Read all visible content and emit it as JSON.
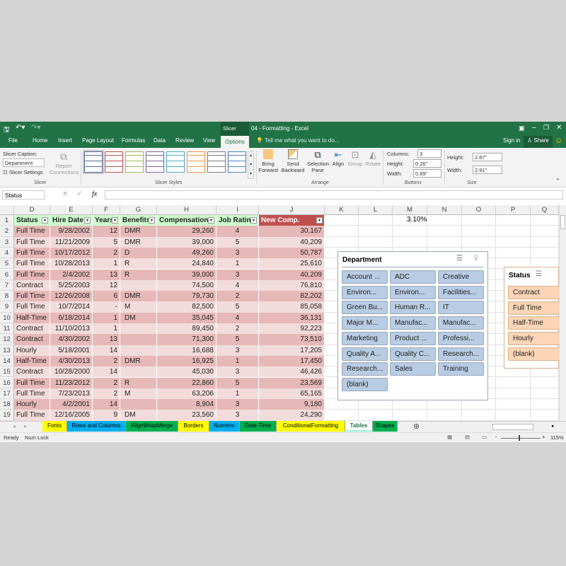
{
  "window": {
    "title": "04 - Formatting - Excel",
    "context_tab": "Slicer Tools",
    "sign_in": "Sign in",
    "share": "Share"
  },
  "ribbon_tabs": [
    "File",
    "Home",
    "Insert",
    "Page Layout",
    "Formulas",
    "Data",
    "Review",
    "View",
    "Options"
  ],
  "active_tab": "Options",
  "tell_me": "Tell me what you want to do...",
  "ribbon": {
    "slicer_caption_label": "Slicer Caption:",
    "slicer_caption_value": "Department",
    "slicer_settings": "Slicer Settings",
    "report_connections": "Report Connections",
    "group_slicer": "Slicer",
    "group_styles": "Slicer Styles",
    "style_colors": [
      "#4f6d9a",
      "#c0504d",
      "#9bbb59",
      "#8064a2",
      "#4bacc6",
      "#f79646",
      "#7f7f7f",
      "#4f81bd"
    ],
    "bring_forward": "Bring Forward",
    "send_backward": "Send Backward",
    "selection_pane": "Selection Pane",
    "align": "Align",
    "group": "Group",
    "rotate": "Rotate",
    "group_arrange": "Arrange",
    "columns_label": "Columns:",
    "columns_value": "3",
    "btn_height_label": "Height:",
    "btn_height_value": "0.26\"",
    "btn_width_label": "Width:",
    "btn_width_value": "0.89\"",
    "group_buttons": "Buttons",
    "size_height_label": "Height:",
    "size_height_value": "2.87\"",
    "size_width_label": "Width:",
    "size_width_value": "2.91\"",
    "group_size": "Size"
  },
  "formula_bar": {
    "name_box": "Status",
    "fx": "fx",
    "formula": ""
  },
  "columns": [
    "D",
    "E",
    "F",
    "G",
    "H",
    "I",
    "J",
    "K",
    "L",
    "M",
    "N",
    "O",
    "P",
    "Q"
  ],
  "table": {
    "headers": [
      "Status",
      "Hire Date",
      "Years",
      "Benefits",
      "Compensation",
      "Job Rating",
      "New Comp."
    ],
    "rows": [
      [
        "Full Time",
        "9/28/2002",
        "12",
        "DMR",
        "29,260",
        "4",
        "30,167"
      ],
      [
        "Full Time",
        "11/21/2009",
        "5",
        "DMR",
        "39,000",
        "5",
        "40,209"
      ],
      [
        "Full Time",
        "10/17/2012",
        "2",
        "D",
        "49,260",
        "3",
        "50,787"
      ],
      [
        "Full Time",
        "10/28/2013",
        "1",
        "R",
        "24,840",
        "1",
        "25,610"
      ],
      [
        "Full Time",
        "2/4/2002",
        "13",
        "R",
        "39,000",
        "3",
        "40,209"
      ],
      [
        "Contract",
        "5/25/2003",
        "12",
        "",
        "74,500",
        "4",
        "76,810"
      ],
      [
        "Full Time",
        "12/26/2008",
        "6",
        "DMR",
        "79,730",
        "2",
        "82,202"
      ],
      [
        "Full Time",
        "10/7/2014",
        "-",
        "M",
        "82,500",
        "5",
        "85,058"
      ],
      [
        "Half-Time",
        "6/18/2014",
        "1",
        "DM",
        "35,045",
        "4",
        "36,131"
      ],
      [
        "Contract",
        "11/10/2013",
        "1",
        "",
        "89,450",
        "2",
        "92,223"
      ],
      [
        "Contract",
        "4/30/2002",
        "13",
        "",
        "71,300",
        "5",
        "73,510"
      ],
      [
        "Hourly",
        "5/18/2001",
        "14",
        "",
        "16,688",
        "3",
        "17,205"
      ],
      [
        "Half-Time",
        "4/30/2013",
        "2",
        "DMR",
        "16,925",
        "1",
        "17,450"
      ],
      [
        "Contract",
        "10/28/2000",
        "14",
        "",
        "45,030",
        "3",
        "46,426"
      ],
      [
        "Full Time",
        "11/23/2012",
        "2",
        "R",
        "22,860",
        "5",
        "23,569"
      ],
      [
        "Full Time",
        "7/23/2013",
        "2",
        "M",
        "63,206",
        "1",
        "65,165"
      ],
      [
        "Hourly",
        "4/2/2001",
        "14",
        "",
        "8,904",
        "3",
        "9,180"
      ],
      [
        "Full Time",
        "12/16/2005",
        "9",
        "DM",
        "23,560",
        "3",
        "24,290"
      ]
    ]
  },
  "m1_value": "3.10%",
  "department_slicer": {
    "title": "Department",
    "items": [
      "Account ...",
      "ADC",
      "Creative",
      "Environ...",
      "Environ...",
      "Facilities...",
      "Green Bu...",
      "Human R...",
      "IT",
      "Major M...",
      "Manufac...",
      "Manufac...",
      "Marketing",
      "Product ...",
      "Professi...",
      "Quality A...",
      "Quality C...",
      "Research...",
      "Research...",
      "Sales",
      "Training",
      "(blank)"
    ]
  },
  "status_slicer": {
    "title": "Status",
    "items": [
      "Contract",
      "Full Time",
      "Half-Time",
      "Hourly",
      "(blank)"
    ]
  },
  "sheet_tabs": [
    {
      "name": "Fonts",
      "color": "#ffff00"
    },
    {
      "name": "Rows and Columns",
      "color": "#00b0f0"
    },
    {
      "name": "AlignWrapMerge",
      "color": "#00b050"
    },
    {
      "name": "Borders",
      "color": "#ffff00"
    },
    {
      "name": "Numeric",
      "color": "#00b0f0"
    },
    {
      "name": "Date-Time",
      "color": "#00b050"
    },
    {
      "name": "ConditionalFormatting",
      "color": "#ffff00"
    },
    {
      "name": "Tables",
      "color": "#ffffff"
    },
    {
      "name": "Shapes",
      "color": "#00b050"
    }
  ],
  "active_sheet": "Tables",
  "status_bar": {
    "ready": "Ready",
    "num_lock": "Num Lock",
    "zoom": "115%"
  }
}
